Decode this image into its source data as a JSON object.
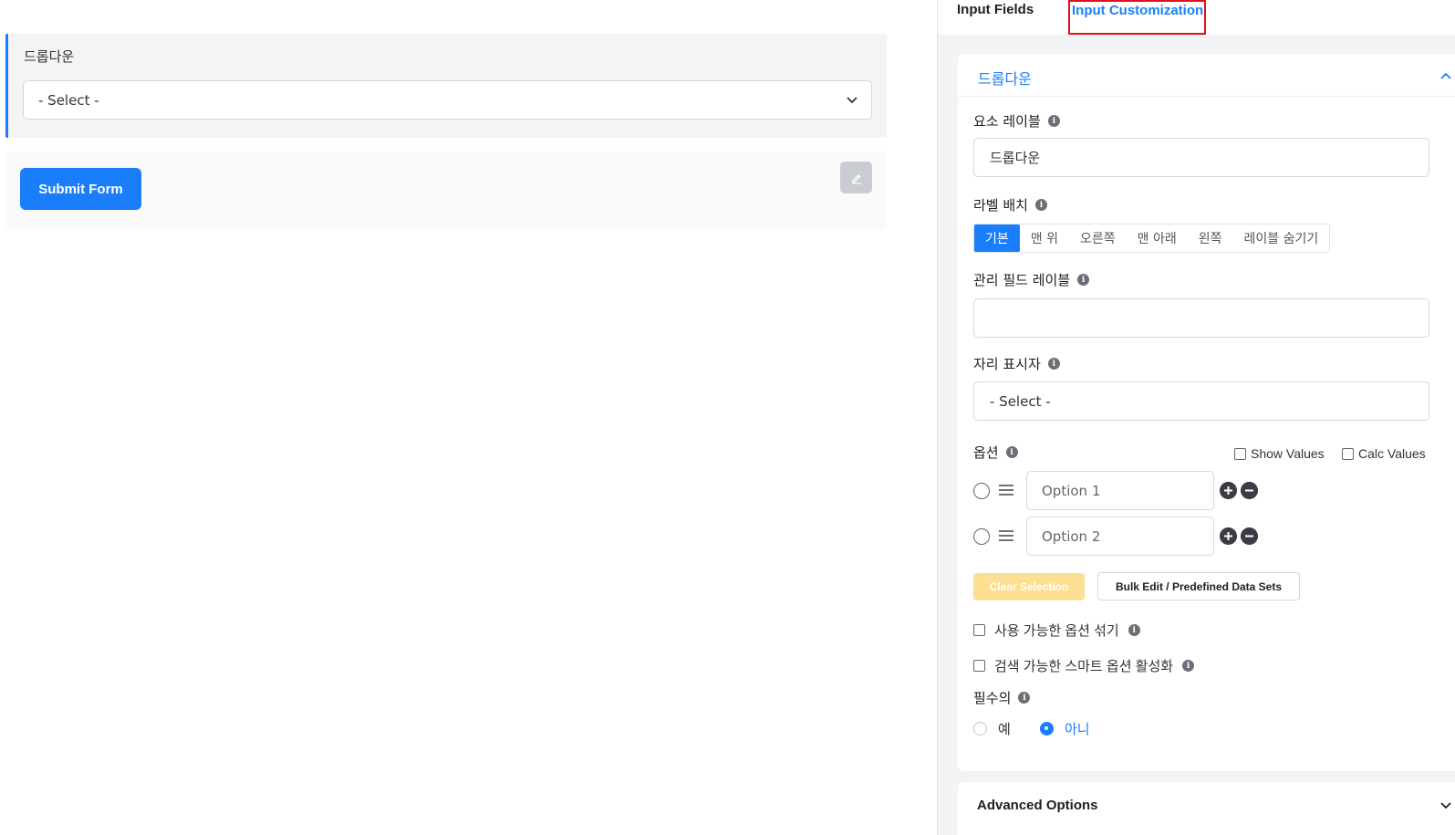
{
  "preview": {
    "field_label": "드롭다운",
    "select_value": "- Select -",
    "submit_label": "Submit Form"
  },
  "tabs": [
    {
      "label": "Input Fields"
    },
    {
      "label": "Input Customization"
    }
  ],
  "panel": {
    "title": "드롭다운",
    "element_label": {
      "label": "요소 레이블",
      "value": "드롭다운"
    },
    "label_placement": {
      "label": "라벨 배치",
      "options": [
        "기본",
        "맨 위",
        "오른쪽",
        "맨 아래",
        "왼쪽",
        "레이블 숨기기"
      ],
      "selected": "기본"
    },
    "admin_label": {
      "label": "관리 필드 레이블",
      "value": ""
    },
    "placeholder": {
      "label": "자리 표시자",
      "value": "- Select -"
    },
    "options": {
      "label": "옵션",
      "show_values": "Show Values",
      "calc_values": "Calc Values",
      "items": [
        "Option 1",
        "Option 2"
      ]
    },
    "clear_selection": "Clear Selection",
    "bulk_edit": "Bulk Edit / Predefined Data Sets",
    "shuffle": "사용 가능한 옵션 섞기",
    "smart_search": "검색 가능한 스마트 옵션 활성화",
    "required": {
      "label": "필수의",
      "yes": "예",
      "no": "아니",
      "selected": "아니"
    }
  },
  "advanced": {
    "title": "Advanced Options"
  },
  "colors": {
    "accent": "#1a7efb",
    "highlight_border": "#e0101c",
    "clear_button": "#fddf92"
  }
}
